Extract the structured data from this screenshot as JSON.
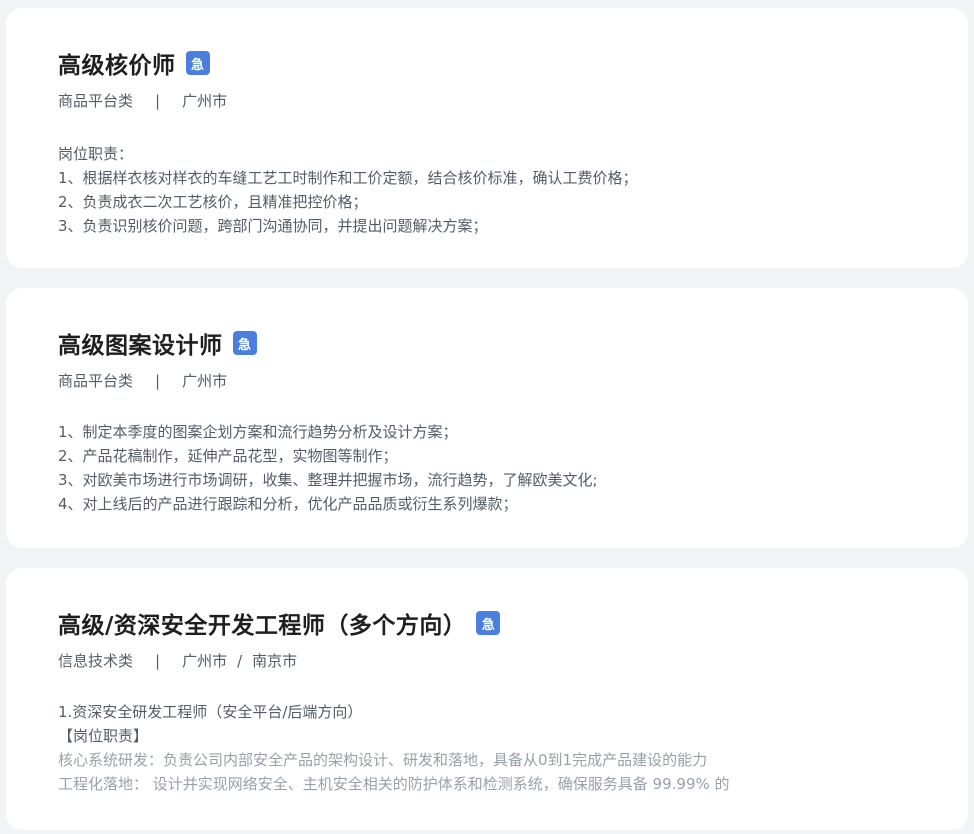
{
  "badge_label": "急",
  "jobs": [
    {
      "title": "高级核价师",
      "category": "商品平台类",
      "separator": "|",
      "cities": [
        "广州市"
      ],
      "lines": [
        "岗位职责：",
        "1、根据样衣核对样衣的车缝工艺工时制作和工价定额，结合核价标准，确认工费价格；",
        "2、负责成衣二次工艺核价，且精准把控价格；",
        "3、负责识别核价问题，跨部门沟通协同，并提出问题解决方案；"
      ]
    },
    {
      "title": "高级图案设计师",
      "category": "商品平台类",
      "separator": "|",
      "cities": [
        "广州市"
      ],
      "lines": [
        "1、制定本季度的图案企划方案和流行趋势分析及设计方案；",
        "2、产品花稿制作，延伸产品花型，实物图等制作；",
        "3、对欧美市场进行市场调研，收集、整理并把握市场，流行趋势，了解欧美文化;",
        "4、对上线后的产品进行跟踪和分析，优化产品品质或衍生系列爆款；"
      ]
    },
    {
      "title": "高级/资深安全开发工程师（多个方向）",
      "category": "信息技术类",
      "separator": "|",
      "city_separator": "/",
      "cities": [
        "广州市",
        "南京市"
      ],
      "lines": [
        "1.资深安全研发工程师（安全平台/后端方向）",
        "【岗位职责】",
        "核心系统研发：负责公司内部安全产品的架构设计、研发和落地，具备从0到1完成产品建设的能力",
        "工程化落地：  设计并实现网络安全、主机安全相关的防护体系和检测系统，确保服务具备 99.99% 的"
      ]
    }
  ]
}
